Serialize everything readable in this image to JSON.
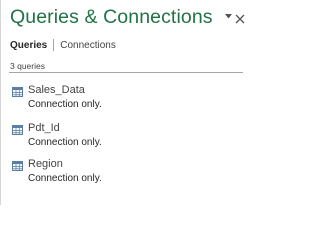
{
  "pane": {
    "title": "Queries & Connections",
    "collapse_icon": "chevron-down-icon",
    "close_icon": "close-icon",
    "accent_color": "#217346"
  },
  "tabs": [
    {
      "label": "Queries",
      "active": true
    },
    {
      "label": "Connections",
      "active": false
    }
  ],
  "query_count_text": "3 queries",
  "queries": [
    {
      "name": "Sales_Data",
      "status": "Connection only.",
      "icon": "table-icon"
    },
    {
      "name": "Pdt_Id",
      "status": "Connection only.",
      "icon": "table-icon"
    },
    {
      "name": "Region",
      "status": "Connection only.",
      "icon": "table-icon"
    }
  ]
}
